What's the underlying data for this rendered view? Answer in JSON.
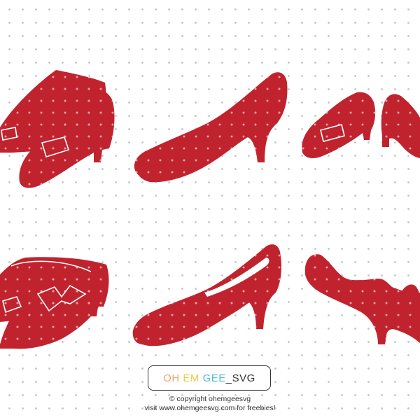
{
  "colors": {
    "shoe": "#c0232e",
    "dot": "#e8a0a6",
    "pattern_dot": "#c9c9c9",
    "logo_oh": "#f4a26d",
    "logo_em": "#f2c64a",
    "logo_gee": "#54b9d3",
    "logo_svg": "#333333"
  },
  "logo": {
    "word1": "OH",
    "word2": "EM",
    "word3": "GEE",
    "word4": "_SVG"
  },
  "credit": {
    "line1": "© copyright ohemgeesvg",
    "line2": "visit www.ohemgeesvg.com for freebies!"
  },
  "shoes": [
    "shoe-pair-1",
    "single-pump-1",
    "shoe-pair-small",
    "shoe-pair-bows",
    "single-pump-2",
    "single-pump-bow"
  ]
}
